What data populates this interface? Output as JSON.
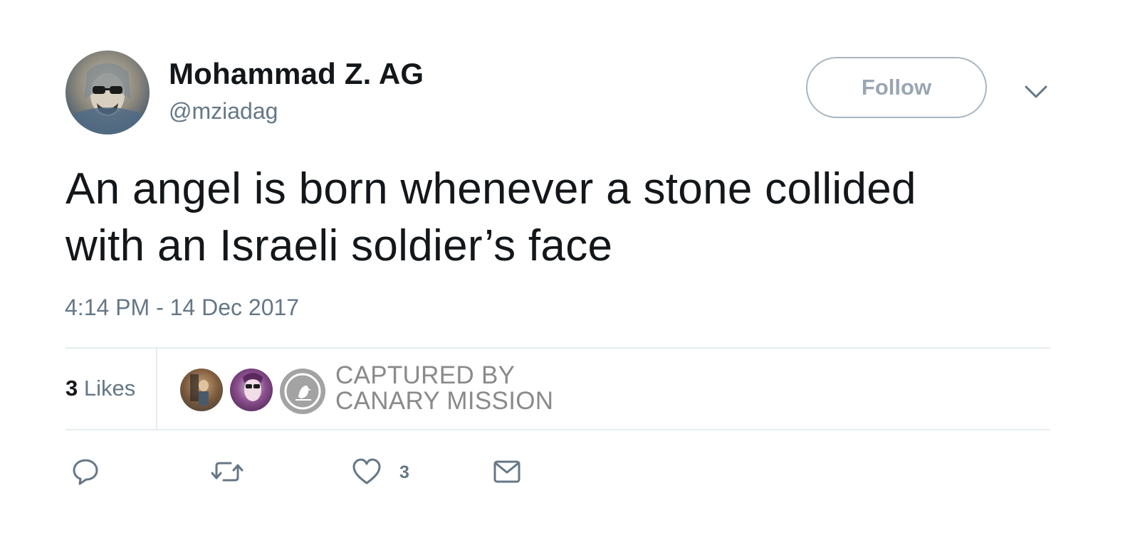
{
  "user": {
    "display_name": "Mohammad Z. AG",
    "handle": "@mziadag"
  },
  "follow_label": "Follow",
  "tweet": {
    "text_line1": "An angel is born whenever a stone collided",
    "text_line2": "with an Israeli soldier’s face",
    "timestamp": "4:14 PM - 14 Dec 2017"
  },
  "stats": {
    "likes_count": "3",
    "likes_label": "Likes"
  },
  "watermark": {
    "line1": "CAPTURED BY",
    "line2": "CANARY MISSION"
  },
  "actions": {
    "like_count": "3",
    "icons": [
      "reply-icon",
      "retweet-icon",
      "heart-icon",
      "envelope-icon"
    ]
  },
  "colors": {
    "text_primary": "#14171a",
    "text_secondary": "#657786",
    "divider": "#e6ecf0",
    "follow_border": "#a9b6c1",
    "watermark_gray": "#8a8a8a"
  }
}
